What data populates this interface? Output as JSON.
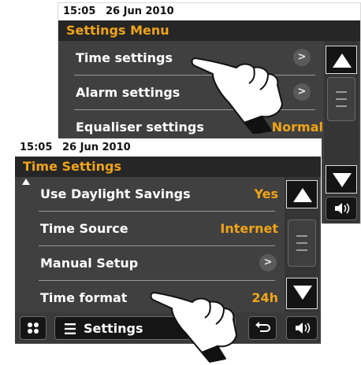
{
  "back_screen": {
    "time": "15:05",
    "date": "26 Jun 2010",
    "title": "Settings Menu",
    "items": [
      {
        "label": "Time settings",
        "chevron": ">"
      },
      {
        "label": "Alarm settings",
        "chevron": ">"
      },
      {
        "label": "Equaliser settings",
        "value": "Normal"
      }
    ]
  },
  "front_screen": {
    "time": "15:05",
    "date": "26 Jun 2010",
    "title": "Time Settings",
    "items": [
      {
        "label": "Use Daylight Savings",
        "value": "Yes"
      },
      {
        "label": "Time Source",
        "value": "Internet"
      },
      {
        "label": "Manual Setup",
        "chevron": ">"
      },
      {
        "label": "Time format",
        "value": "24h"
      }
    ],
    "bottom_bar": {
      "settings_label": "Settings"
    }
  },
  "colors": {
    "accent": "#f0a418",
    "screen_bg": "#404040",
    "title_bar": "#262626"
  },
  "icons": [
    "pointing-hand-icon",
    "scroll-up-icon",
    "scroll-down-icon",
    "volume-icon",
    "grid-menu-icon",
    "list-menu-icon",
    "back-arrow-icon",
    "scroll-top-marker-icon"
  ]
}
